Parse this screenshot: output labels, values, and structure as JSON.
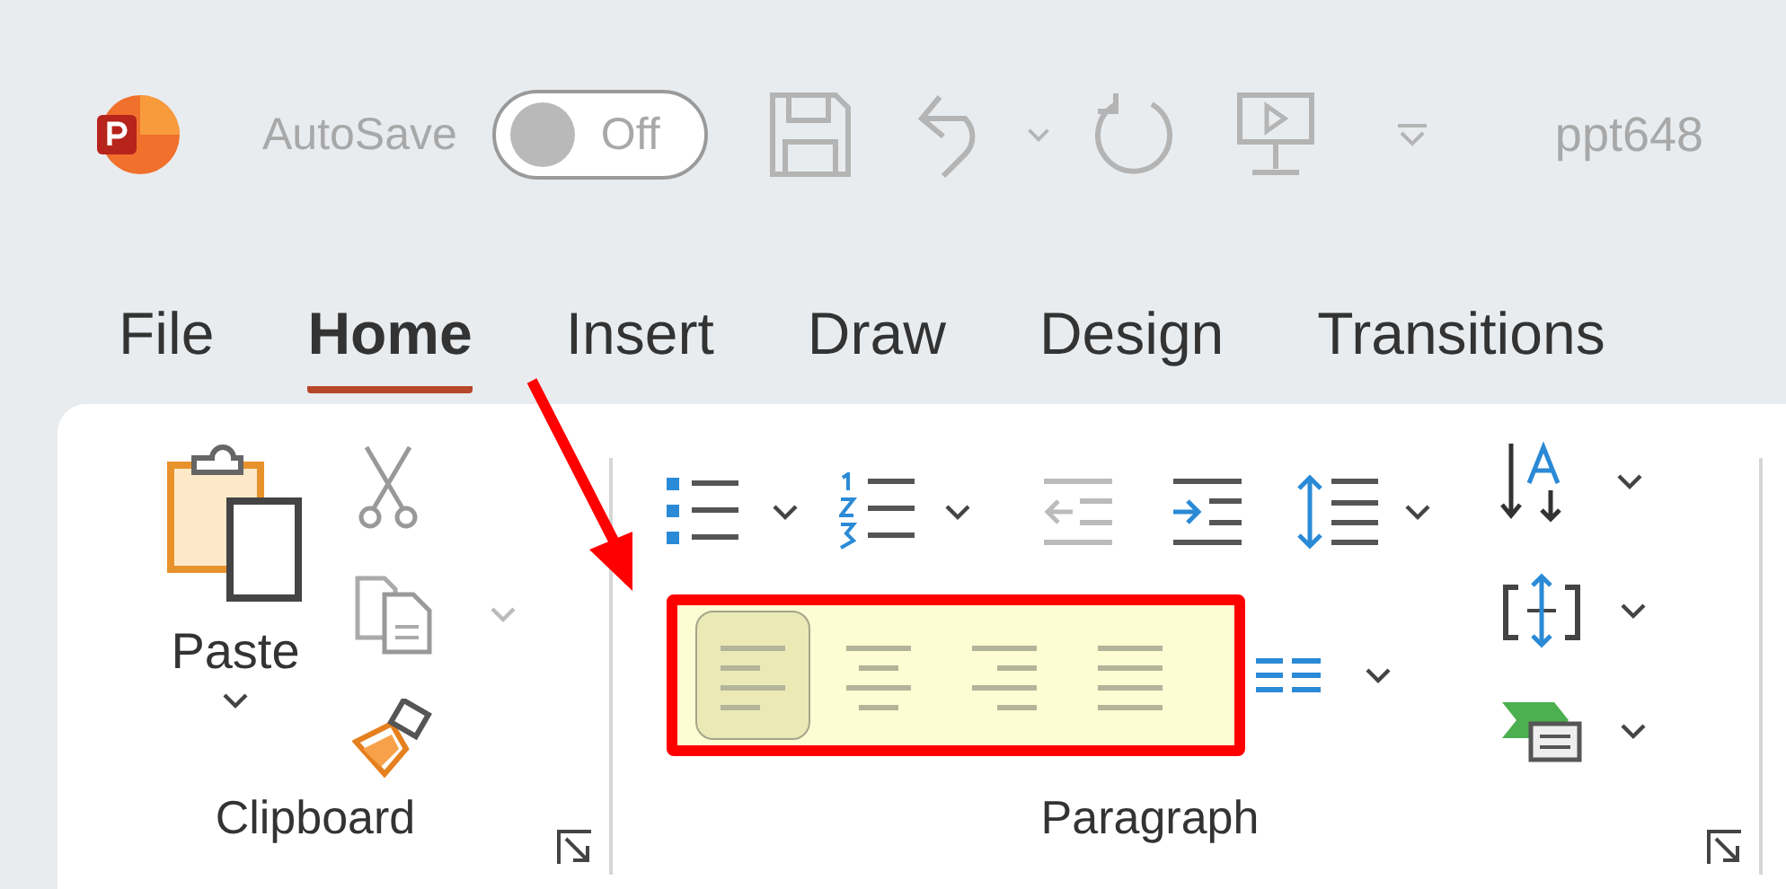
{
  "title_bar": {
    "autosave_label": "AutoSave",
    "autosave_toggle": {
      "label": "Off",
      "on": false
    },
    "file_name": "ppt648"
  },
  "tabs": [
    {
      "label": "File",
      "selected": false
    },
    {
      "label": "Home",
      "selected": true
    },
    {
      "label": "Insert",
      "selected": false
    },
    {
      "label": "Draw",
      "selected": false
    },
    {
      "label": "Design",
      "selected": false
    },
    {
      "label": "Transitions",
      "selected": false
    }
  ],
  "clipboard": {
    "paste_label": "Paste",
    "group_label": "Clipboard"
  },
  "paragraph": {
    "group_label": "Paragraph",
    "alignment": [
      {
        "kind": "left",
        "selected": true
      },
      {
        "kind": "center",
        "selected": false
      },
      {
        "kind": "right",
        "selected": false
      },
      {
        "kind": "justify",
        "selected": false
      }
    ]
  }
}
